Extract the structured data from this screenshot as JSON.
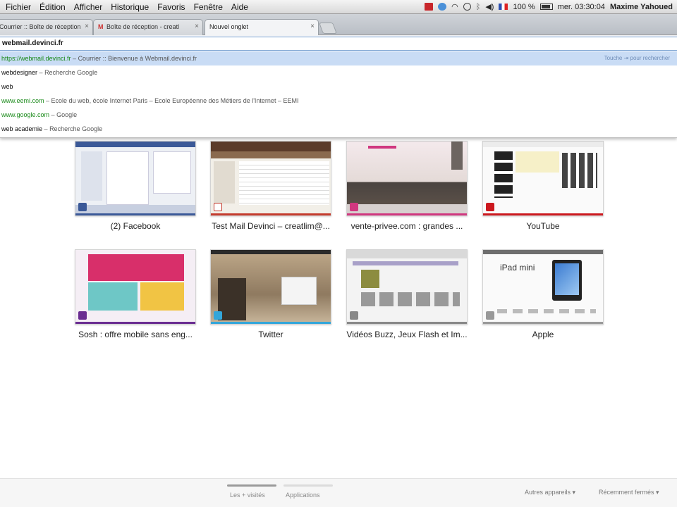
{
  "menubar": {
    "items": [
      "Fichier",
      "Édition",
      "Afficher",
      "Historique",
      "Favoris",
      "Fenêtre",
      "Aide"
    ],
    "battery": "100 %",
    "clock": "mer. 03:30:04",
    "user": "Maxime Yahoued"
  },
  "tabs": [
    {
      "title": "Courrier :: Boîte de réception"
    },
    {
      "title": "Boîte de réception - creatl"
    },
    {
      "title": "Nouvel onglet"
    }
  ],
  "omnibox": {
    "value": "webmail.devinci.fr"
  },
  "suggestions": [
    {
      "url": "https://webmail.devinci.fr",
      "sep": " – ",
      "desc": "Courrier :: Bienvenue à Webmail.devinci.fr",
      "hint": "Touche ⇥ pour rechercher"
    },
    {
      "query": "webdesigner",
      "sep": " – ",
      "desc": "Recherche Google"
    },
    {
      "query": "web"
    },
    {
      "url": "www.eemi.com",
      "sep": " – ",
      "desc": "Ecole du web, école Internet Paris – Ecole Européenne des Métiers de l'Internet – EEMI"
    },
    {
      "url": "www.google.com",
      "sep": " – ",
      "desc": "Google"
    },
    {
      "query": "web academie",
      "sep": " – ",
      "desc": "Recherche Google"
    }
  ],
  "tiles": [
    {
      "title": "(2) Facebook",
      "color": "#3b5998"
    },
    {
      "title": "Test Mail Devinci – creatlim@...",
      "color": "#c43b2d"
    },
    {
      "title": "vente-privee.com : grandes ...",
      "color": "#d0377f"
    },
    {
      "title": "YouTube",
      "color": "#cc181e"
    },
    {
      "title": "Sosh : offre mobile sans eng...",
      "color": "#6a2d91"
    },
    {
      "title": "Twitter",
      "color": "#33a6da"
    },
    {
      "title": "Vidéos Buzz, Jeux Flash et Im...",
      "color": "#888888"
    },
    {
      "title": "Apple",
      "color": "#999999"
    }
  ],
  "bottom": {
    "most_visited": "Les + visités",
    "apps": "Applications",
    "other_devices": "Autres appareils ▾",
    "recently_closed": "Récemment fermés ▾"
  },
  "thumb_text": {
    "ipad": "iPad mini"
  }
}
